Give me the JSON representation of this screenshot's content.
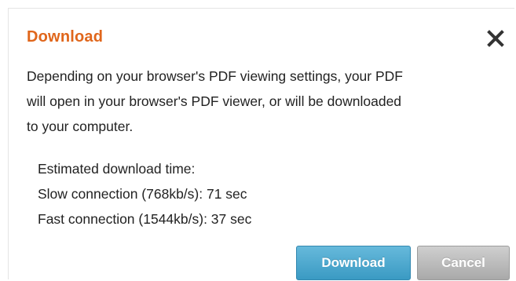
{
  "dialog": {
    "title": "Download",
    "message_lines": [
      "Depending on your browser's PDF viewing settings, your PDF",
      "will open in your browser's PDF viewer, or will be downloaded",
      "to your computer."
    ],
    "estimate_heading": "Estimated download time:",
    "slow_connection": "Slow connection (768kb/s): 71 sec",
    "fast_connection": "Fast connection (1544kb/s): 37 sec",
    "download_label": "Download",
    "cancel_label": "Cancel",
    "close_icon": "close-x-icon"
  },
  "colors": {
    "title": "#e0661b",
    "download_button": "#4aa6ce",
    "cancel_button": "#b9b9b9"
  }
}
